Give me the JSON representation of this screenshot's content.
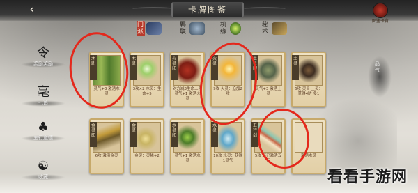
{
  "header": {
    "back_icon": "‹",
    "title": "卡牌图鉴",
    "gallery_label": "图鉴卡背"
  },
  "tabs": [
    {
      "label": "门派",
      "icon": "sect-icon",
      "active": true
    },
    {
      "label": "羁联",
      "icon": "bond-icon",
      "active": false
    },
    {
      "label": "机缘",
      "icon": "fortune-icon",
      "active": false
    },
    {
      "label": "秘术",
      "icon": "secret-icon",
      "active": false
    }
  ],
  "sidenav": [
    {
      "glyph": "令",
      "label": "奖励奖励"
    },
    {
      "glyph": "毫",
      "label": "七追"
    },
    {
      "glyph": "♣",
      "label": "五行道德"
    },
    {
      "glyph": "☯",
      "label": "收藏"
    }
  ],
  "right_seal": {
    "label": "品气"
  },
  "cards": [
    {
      "tag": "木灵·",
      "cost": "",
      "desc": "灵气+3 激活木灵",
      "art": "bamboo"
    },
    {
      "tag": "木灵",
      "cost": "",
      "desc": "3攻×2 木灵：生命+5",
      "art": "orb"
    },
    {
      "tag": "火灵印",
      "cost": "",
      "desc": "对方减3生命上限 灵气+1 激活火灵",
      "art": "seal"
    },
    {
      "tag": "火灵",
      "cost": "",
      "desc": "9攻 火灵：追加2攻",
      "art": "fire"
    },
    {
      "tag": "土灵印",
      "cost": "",
      "desc": "灵气+3 激活土灵",
      "art": "house"
    },
    {
      "tag": "土灵",
      "cost": "",
      "desc": "6攻 灵合 土灵：获得4防 多1",
      "art": "fig"
    },
    {
      "tag": "金灵印",
      "cost": "",
      "desc": "6攻 激活金灵",
      "art": "tri"
    },
    {
      "tag": "金灵",
      "cost": "",
      "desc": "金灵：灵鳞+2",
      "art": "moon"
    },
    {
      "tag": "水灵印",
      "cost": "",
      "desc": "灵气+1 激活水灵",
      "art": "leaf"
    },
    {
      "tag": "水灵",
      "cost": "",
      "desc": "10攻 水灵：获得1灵气",
      "art": "wave"
    },
    {
      "tag": "五行剑",
      "cost": "",
      "desc": "5攻 若已激活五行",
      "art": "blade"
    },
    {
      "tag": "",
      "cost": "",
      "desc": "激活木灵",
      "art": "blank"
    }
  ],
  "watermark": "看看手游网"
}
